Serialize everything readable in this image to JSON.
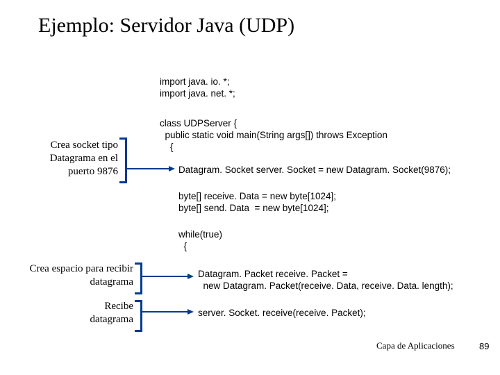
{
  "title": "Ejemplo: Servidor Java (UDP)",
  "code": {
    "imports": "import java. io. *;\nimport java. net. *;",
    "class_open": "class UDPServer {\n  public static void main(String args[]) throws Exception\n    {",
    "socket": "Datagram. Socket server. Socket = new Datagram. Socket(9876);",
    "buffers": "byte[] receive. Data = new byte[1024];\nbyte[] send. Data  = new byte[1024];",
    "while": "while(true)\n  {",
    "packet": "Datagram. Packet receive. Packet =\n  new Datagram. Packet(receive. Data, receive. Data. length);",
    "receive": "server. Socket. receive(receive. Packet);"
  },
  "annotations": {
    "a1": "Crea socket tipo\nDatagrama en el\npuerto 9876",
    "a2": "Crea espacio para\nrecibir datagrama",
    "a3": "Recibe\ndatagrama"
  },
  "footer": {
    "label": "Capa de Aplicaciones",
    "page": "89"
  }
}
